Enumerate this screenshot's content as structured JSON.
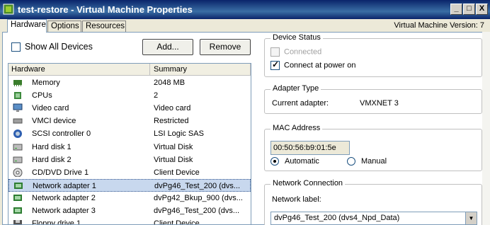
{
  "window": {
    "title": "test-restore - Virtual Machine Properties",
    "version_text": "Virtual Machine Version: 7",
    "controls": {
      "minimize": "_",
      "maximize": "□",
      "close": "X"
    }
  },
  "tabs": [
    {
      "label": "Hardware",
      "active": true
    },
    {
      "label": "Options",
      "active": false
    },
    {
      "label": "Resources",
      "active": false
    }
  ],
  "hardware": {
    "show_all_label": "Show All Devices",
    "show_all_checked": false,
    "add_label": "Add...",
    "remove_label": "Remove",
    "columns": [
      "Hardware",
      "Summary"
    ],
    "rows": [
      {
        "name": "Memory",
        "summary": "2048 MB",
        "icon": "memory-icon"
      },
      {
        "name": "CPUs",
        "summary": "2",
        "icon": "cpu-icon"
      },
      {
        "name": "Video card",
        "summary": "Video card",
        "icon": "video-card-icon"
      },
      {
        "name": "VMCI device",
        "summary": "Restricted",
        "icon": "vmci-device-icon"
      },
      {
        "name": "SCSI controller 0",
        "summary": "LSI Logic SAS",
        "icon": "scsi-controller-icon"
      },
      {
        "name": "Hard disk 1",
        "summary": "Virtual Disk",
        "icon": "hard-disk-icon"
      },
      {
        "name": "Hard disk 2",
        "summary": "Virtual Disk",
        "icon": "hard-disk-icon"
      },
      {
        "name": "CD/DVD Drive 1",
        "summary": "Client Device",
        "icon": "cd-dvd-icon"
      },
      {
        "name": "Network adapter 1",
        "summary": "dvPg46_Test_200 (dvs...",
        "icon": "network-adapter-icon",
        "selected": true
      },
      {
        "name": "Network adapter 2",
        "summary": "dvPg42_Bkup_900 (dvs...",
        "icon": "network-adapter-icon"
      },
      {
        "name": "Network adapter 3",
        "summary": "dvPg46_Test_200 (dvs...",
        "icon": "network-adapter-icon"
      },
      {
        "name": "Floppy drive 1",
        "summary": "Client Device",
        "icon": "floppy-drive-icon"
      }
    ]
  },
  "device_status": {
    "legend": "Device Status",
    "connected_label": "Connected",
    "connected_checked": false,
    "connect_power_label": "Connect at power on",
    "connect_power_checked": true
  },
  "adapter_type": {
    "legend": "Adapter Type",
    "current_label": "Current adapter:",
    "current_value": "VMXNET 3"
  },
  "mac_address": {
    "legend": "MAC Address",
    "value": "00:50:56:b9:01:5e",
    "automatic_label": "Automatic",
    "manual_label": "Manual",
    "selected": "Automatic"
  },
  "network_connection": {
    "legend": "Network Connection",
    "label": "Network label:",
    "selected": "dvPg46_Test_200 (dvs4_Npd_Data)"
  },
  "colors": {
    "titlebar": "#0a246a",
    "selection": "#c8d8ee",
    "window_bg": "#ece9d8"
  }
}
